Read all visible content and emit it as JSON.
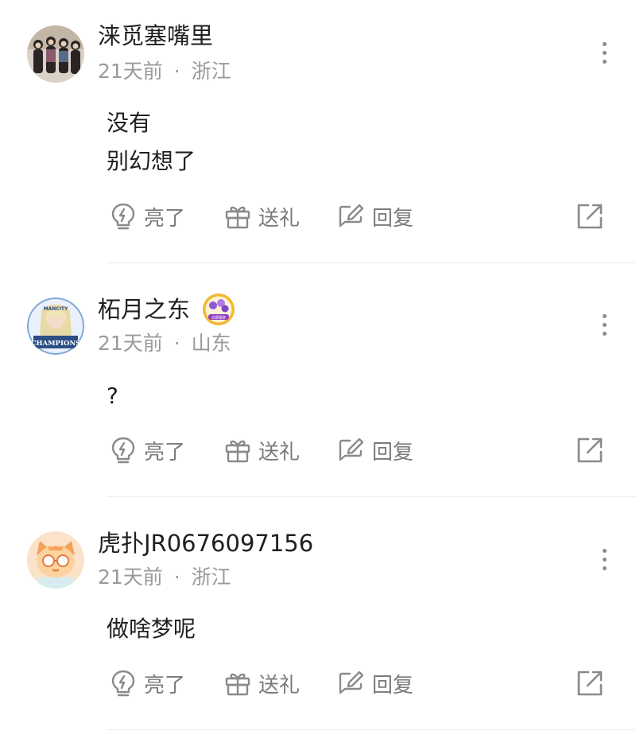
{
  "comments": [
    {
      "username": "涞觅塞嘴里",
      "time": "21天前",
      "separator": "·",
      "location": "浙江",
      "lines": [
        "没有",
        "别幻想了"
      ],
      "avatar_icon": "group-photo-avatar"
    },
    {
      "username": "柘月之东",
      "time": "21天前",
      "separator": "·",
      "location": "山东",
      "lines": [
        "?"
      ],
      "avatar_icon": "champions-avatar",
      "avatar_text_top": "MANCITY",
      "avatar_text_bottom": "CHAMPIONS",
      "badge_icon": "fan-badge-icon",
      "badge_text": "应援徽章"
    },
    {
      "username": "虎扑JR0676097156",
      "time": "21天前",
      "separator": "·",
      "location": "浙江",
      "lines": [
        "做啥梦呢"
      ],
      "avatar_icon": "cat-glasses-avatar"
    }
  ],
  "actions": {
    "like": "亮了",
    "gift": "送礼",
    "reply": "回复"
  },
  "colors": {
    "text": "#1f1f1f",
    "meta": "#9a9a9a",
    "action": "#7a7a7a",
    "divider": "#ececec"
  }
}
